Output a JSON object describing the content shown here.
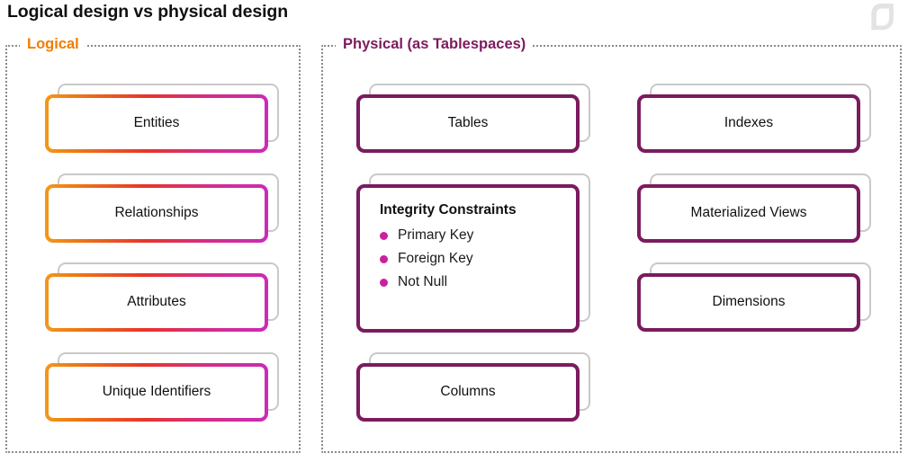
{
  "page": {
    "title": "Logical design vs physical design",
    "logo_icon": "leaf-logo-watermark",
    "colors": {
      "logical_accent": "#F07D00",
      "physical_accent": "#7B1B5E",
      "bullet": "#C9219E",
      "ghost_card": "#C9C9C9",
      "panel_border": "#8A8A8A",
      "gradient_start": "#F3981B",
      "gradient_mid": "#E8342A",
      "gradient_end": "#CB2BB8"
    }
  },
  "panels": {
    "logical": {
      "label": "Logical",
      "cards": [
        {
          "label": "Entities"
        },
        {
          "label": "Relationships"
        },
        {
          "label": "Attributes"
        },
        {
          "label": "Unique Identifiers"
        }
      ]
    },
    "physical": {
      "label": "Physical (as Tablespaces)",
      "column_left": [
        {
          "label": "Tables"
        },
        {
          "label": "Integrity Constraints",
          "items": [
            "Primary Key",
            "Foreign Key",
            "Not Null"
          ]
        },
        {
          "label": "Columns"
        }
      ],
      "column_right": [
        {
          "label": "Indexes"
        },
        {
          "label": "Materialized Views"
        },
        {
          "label": "Dimensions"
        }
      ]
    }
  }
}
